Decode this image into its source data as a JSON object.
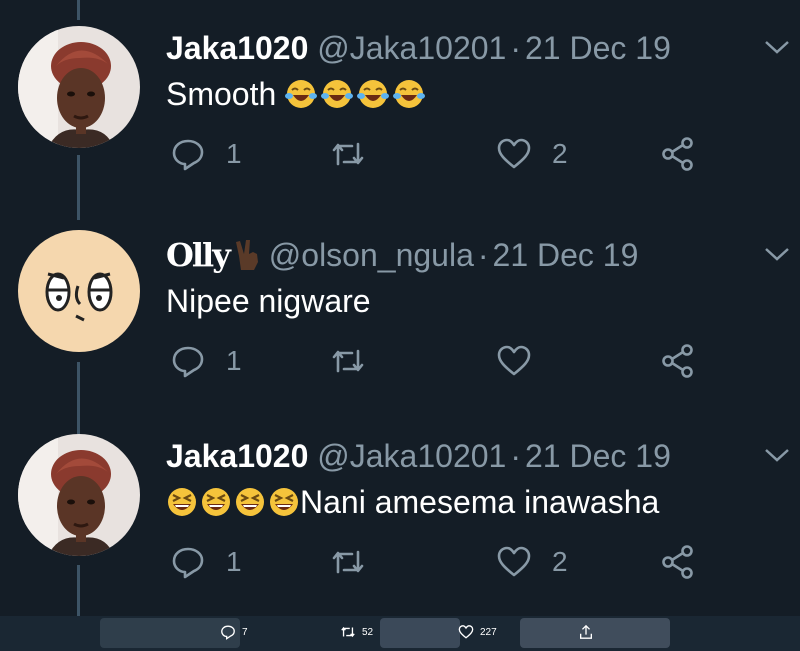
{
  "tweets": [
    {
      "name": "Jaka1020",
      "handle": "@Jaka10201",
      "separator": "·",
      "date": "21 Dec 19",
      "text": "Smooth ",
      "emojis": [
        "face-with-tears-of-joy",
        "face-with-tears-of-joy",
        "face-with-tears-of-joy",
        "face-with-tears-of-joy"
      ],
      "emoji_position": "after",
      "replies": "1",
      "retweets": "",
      "likes": "2",
      "avatar": "woman-photo"
    },
    {
      "name": "Olly",
      "name_emoji": "victory-hand-dark",
      "handle": "@olson_ngula",
      "separator": "·",
      "date": "21 Dec 19",
      "text": "Nipee nigware",
      "emojis": [],
      "replies": "1",
      "retweets": "",
      "likes": "",
      "avatar": "cartoon-face"
    },
    {
      "name": "Jaka1020",
      "handle": "@Jaka10201",
      "separator": "·",
      "date": "21 Dec 19",
      "text": "Nani amesema inawasha",
      "emojis": [
        "grinning-squinting-face",
        "grinning-squinting-face",
        "grinning-squinting-face",
        "grinning-squinting-face"
      ],
      "emoji_position": "before",
      "replies": "1",
      "retweets": "",
      "likes": "2",
      "avatar": "woman-photo"
    }
  ],
  "bottom_bar": {
    "replies": "7",
    "retweets": "52",
    "likes": "227"
  },
  "colors": {
    "background": "#141d26",
    "muted_text": "#8899a6",
    "thread_line": "#3d5466"
  },
  "icons": [
    "reply-icon",
    "retweet-icon",
    "like-icon",
    "share-icon",
    "chevron-down-icon",
    "upload-icon"
  ]
}
